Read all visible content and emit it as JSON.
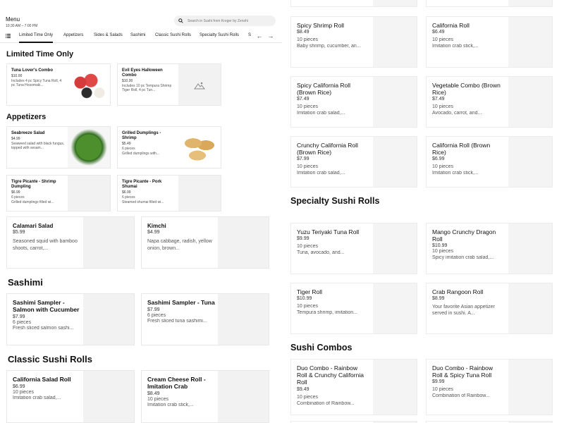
{
  "header": {
    "menu_title": "Menu",
    "hours": "10:30 AM – 7:00 PM"
  },
  "search": {
    "placeholder": "Search in Sushi from Kroger by Zenshi"
  },
  "icons": {
    "search": "search-icon",
    "list": "list-icon",
    "prev": "arrow-left-icon",
    "next": "arrow-right-icon",
    "placeholder": "image-placeholder-icon"
  },
  "tabs": [
    "Limited Time Only",
    "Appetizers",
    "Sides & Salads",
    "Sashimi",
    "Classic Sushi Rolls",
    "Specialty Sushi Rolls",
    "S"
  ],
  "sections": {
    "limited": "Limited Time Only",
    "appetizers": "Appetizers",
    "sashimi": "Sashimi",
    "classic": "Classic Sushi Rolls",
    "specialty": "Specialty Sushi Rolls",
    "combos": "Sushi Combos"
  },
  "limited_items": [
    {
      "name": "Tuna Lover's Combo",
      "price": "$10.00",
      "desc": "Includes 4 pc Spicy Tuna Roll, 4 pc Tuna Hosomaki..."
    },
    {
      "name": "Evil Eyes Halloween Combo",
      "price": "$10.00",
      "desc": "Includes 10 pc Tempura Shrimp Tiger Roll, 4 pc Tun..."
    }
  ],
  "appetizer_items": [
    {
      "name": "Seabreeze Salad",
      "price": "$4.99",
      "desc": "Seaweed salad with black fungus, topped with sesam..."
    },
    {
      "name": "Grilled Dumplings - Shrimp",
      "price": "$5.49",
      "pieces": "6 pieces",
      "desc": "Grilled dumplings with..."
    },
    {
      "name": "Tigre Picante - Shrimp Dumpling",
      "price": "$6.99",
      "pieces": "6 pieces",
      "desc": "Grilled dumplings filled wi..."
    },
    {
      "name": "Tigre Picante - Pork Shumai",
      "price": "$6.99",
      "pieces": "6 pieces",
      "desc": "Steamed shumai filled wi..."
    },
    {
      "name": "Calamari Salad",
      "price": "$5.99",
      "desc": "Seasoned squid with bamboo shoots, carrot,..."
    },
    {
      "name": "Kimchi",
      "price": "$4.99",
      "desc": "Napa cabbage, radish, yellow onion, brown..."
    }
  ],
  "sashimi_items": [
    {
      "name": "Sashimi Sampler - Salmon with Cucumber",
      "price": "$7.99",
      "pieces": "6 pieces",
      "desc": "Fresh sliced salmon sashi..."
    },
    {
      "name": "Sashimi Sampler - Tuna",
      "price": "$7.99",
      "pieces": "6 pieces",
      "desc": "Fresh sliced tuna sashimi..."
    }
  ],
  "classic_left_items": [
    {
      "name": "California Salad Roll",
      "price": "$6.99",
      "pieces": "10 pieces",
      "desc": "Imitation crab salad,..."
    },
    {
      "name": "Cream Cheese Roll - Imitation Crab",
      "price": "$8.49",
      "pieces": "10 pieces",
      "desc": "Imitation crab stick,..."
    }
  ],
  "classic_right_items": [
    {
      "name": "Spicy Shrimp Roll",
      "price": "$8.49",
      "pieces": "10 pieces",
      "desc": "Baby shrimp, cucumber, an..."
    },
    {
      "name": "California Roll",
      "price": "$6.49",
      "pieces": "10 pieces",
      "desc": "Imitation crab stick,..."
    },
    {
      "name": "Spicy California Roll (Brown Rice)",
      "price": "$7.49",
      "pieces": "10 pieces",
      "desc": "Imitation crab salad,..."
    },
    {
      "name": "Vegetable Combo (Brown Rice)",
      "price": "$7.49",
      "pieces": "10 pieces",
      "desc": "Avocado, carrot, and..."
    },
    {
      "name": "Crunchy California Roll (Brown Rice)",
      "price": "$7.99",
      "pieces": "10 pieces",
      "desc": "Imitation crab salad,..."
    },
    {
      "name": "California Roll (Brown Rice)",
      "price": "$6.99",
      "pieces": "10 pieces",
      "desc": "Imitation crab stick,..."
    }
  ],
  "specialty_items": [
    {
      "name": "Yuzu Teriyaki Tuna Roll",
      "price": "$9.99",
      "pieces": "10 pieces",
      "desc": "Tuna, avocado, and..."
    },
    {
      "name": "Mango Crunchy Dragon Roll",
      "price": "$10.99",
      "pieces": "10 pieces",
      "desc": "Spicy imitation crab salad,..."
    },
    {
      "name": "Tiger Roll",
      "price": "$10.99",
      "pieces": "10 pieces",
      "desc": "Tempura shrimp, imitation..."
    },
    {
      "name": "Crab Rangoon Roll",
      "price": "$8.99",
      "desc": "Your favorite Asian appetizer served in sushi. A..."
    }
  ],
  "combo_items": [
    {
      "name": "Duo Combo - Rainbow Roll & Crunchy California Roll",
      "price": "$9.49",
      "pieces": "10 pieces",
      "desc": "Combination of Rainbow..."
    },
    {
      "name": "Duo Combo - Rainbow Roll & Spicy Tuna Roll",
      "price": "$9.99",
      "pieces": "10 pieces",
      "desc": "Combination of Rainbow..."
    }
  ]
}
